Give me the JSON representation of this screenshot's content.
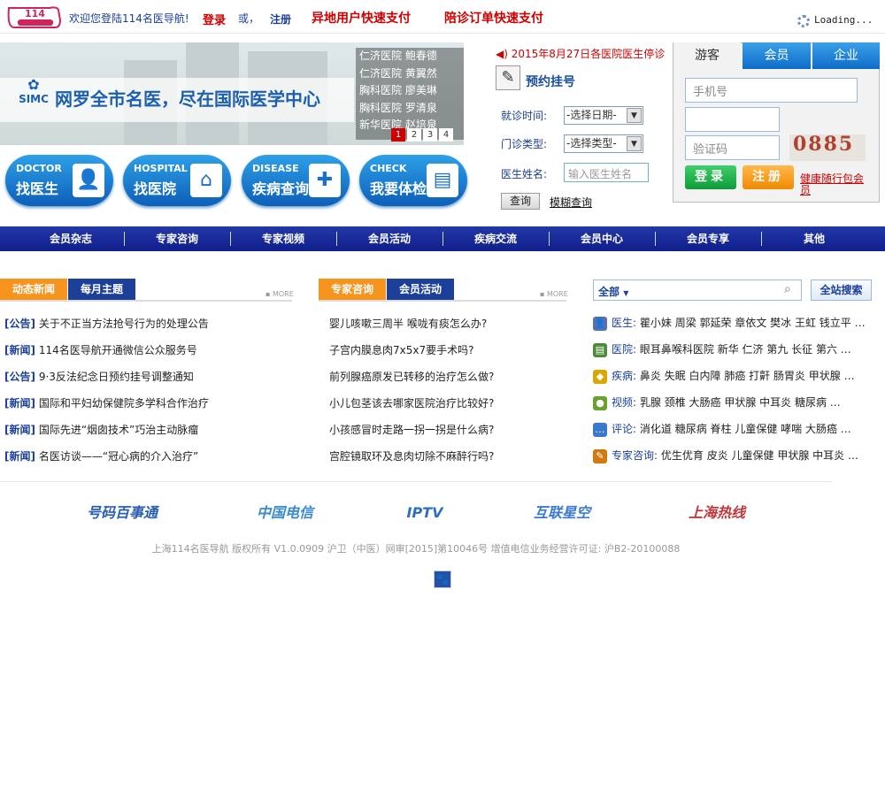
{
  "topbar": {
    "logo_text": "114名医导航",
    "welcome": "欢迎您登陆114名医导航!",
    "login": "登录",
    "or": "或，",
    "register": "注册",
    "remote_pay": "异地用户快速支付",
    "escort_pay": "陪诊订单快速支付",
    "loading": "Loading..."
  },
  "banner": {
    "slogan": "网罗全市名医，尽在国际医学中心",
    "simc": "SIMC",
    "hospitals": [
      {
        "hospital": "仁济医院",
        "doctor": "鲍春德"
      },
      {
        "hospital": "仁济医院",
        "doctor": "黄翼然"
      },
      {
        "hospital": "胸科医院",
        "doctor": "廖美琳"
      },
      {
        "hospital": "胸科医院",
        "doctor": "罗清泉"
      },
      {
        "hospital": "新华医院",
        "doctor": "赵培泉"
      }
    ],
    "pages": [
      "1",
      "2",
      "3",
      "4"
    ]
  },
  "quick_buttons": [
    {
      "en": "DOCTOR",
      "cn": "找医生",
      "icon": "doctor-icon"
    },
    {
      "en": "HOSPITAL",
      "cn": "找医院",
      "icon": "hospital-search-icon"
    },
    {
      "en": "DISEASE",
      "cn": "疾病查询",
      "icon": "medkit-icon"
    },
    {
      "en": "CHECK",
      "cn": "我要体检",
      "icon": "checkup-icon"
    }
  ],
  "appointment": {
    "notice": "2015年8月27日各医院医生停诊",
    "title": "预约挂号",
    "date_label": "就诊时间:",
    "date_value": "-选择日期-",
    "type_label": "门诊类型:",
    "type_value": "-选择类型-",
    "doctor_label": "医生姓名:",
    "doctor_placeholder": "输入医生姓名",
    "query": "查询",
    "fuzzy_query": "模糊查询"
  },
  "login": {
    "tabs": [
      "游客",
      "会员",
      "企业"
    ],
    "phone_placeholder": "手机号",
    "code_placeholder": "验证码",
    "captcha": "0885",
    "login_btn": "登录",
    "register_btn": "注册",
    "health_member": "健康随行包会员"
  },
  "nav": [
    "会员杂志",
    "专家咨询",
    "专家视频",
    "会员活动",
    "疾病交流",
    "会员中心",
    "会员专享",
    "其他"
  ],
  "news": {
    "tab_active": "动态新闻",
    "tab_other": "每月主题",
    "more": "MORE",
    "items": [
      {
        "tag": "[公告]",
        "text": "关于不正当方法抢号行为的处理公告"
      },
      {
        "tag": "[新闻]",
        "text": "114名医导航开通微信公众服务号"
      },
      {
        "tag": "[公告]",
        "text": "9·3反法纪念日预约挂号调整通知"
      },
      {
        "tag": "[新闻]",
        "text": "国际和平妇幼保健院多学科合作治疗"
      },
      {
        "tag": "[新闻]",
        "text": "国际先进“烟囱技术”巧治主动脉瘤"
      },
      {
        "tag": "[新闻]",
        "text": "名医访谈——“冠心病的介入治疗”"
      }
    ]
  },
  "consult": {
    "tab_active": "专家咨询",
    "tab_other": "会员活动",
    "more": "MORE",
    "items": [
      "婴儿咳嗽三周半 喉咙有痰怎么办?",
      "子宫内膜息肉7x5x7要手术吗?",
      "前列腺癌原发已转移的治疗怎么做?",
      "小儿包茎该去哪家医院治疗比较好?",
      "小孩感冒时走路一拐一拐是什么病?",
      "宫腔镜取环及息肉切除不麻醉行吗?"
    ]
  },
  "search": {
    "scope": "全部",
    "button": "全站搜索",
    "rows": [
      {
        "label": "医生:",
        "icon": "person-icon",
        "color": "#5a6fb0",
        "text": "瞿小妹 周梁 郭延荣 章依文 樊冰 王虹 钱立平 …"
      },
      {
        "label": "医院:",
        "icon": "hospital-icon",
        "color": "#4d8a3a",
        "text": "眼耳鼻喉科医院 新华 仁济 第九 长征 第六 …"
      },
      {
        "label": "疾病:",
        "icon": "shield-icon",
        "color": "#d8a800",
        "text": "鼻炎 失眠 白内障 肺癌 打鼾 肠胃炎 甲状腺 …"
      },
      {
        "label": "视频:",
        "icon": "video-icon",
        "color": "#6aa030",
        "text": "乳腺 颈椎 大肠癌 甲状腺 中耳炎 糖尿病 …"
      },
      {
        "label": "评论:",
        "icon": "comment-icon",
        "color": "#3a78c8",
        "text": "消化道 糖尿病 脊柱 儿童保健 哮喘 大肠癌 …"
      },
      {
        "label": "专家咨询:",
        "icon": "edit-icon",
        "color": "#d07a10",
        "text": "优生优育 皮炎 儿童保健 甲状腺 中耳炎 …"
      }
    ]
  },
  "partners": [
    {
      "name": "号码百事通",
      "color": "#2a5fb0"
    },
    {
      "name": "中国电信",
      "color": "#3a8ad0"
    },
    {
      "name": "IPTV",
      "color": "#2a6fc0"
    },
    {
      "name": "互联星空",
      "color": "#3a7ad0"
    },
    {
      "name": "上海热线",
      "color": "#c0383a"
    }
  ],
  "footer": {
    "copyright": "上海114名医导航 版权所有 V1.0.0909 沪卫（中医）网审[2015]第10046号 增值电信业务经营许可证: 沪B2-20100088"
  }
}
